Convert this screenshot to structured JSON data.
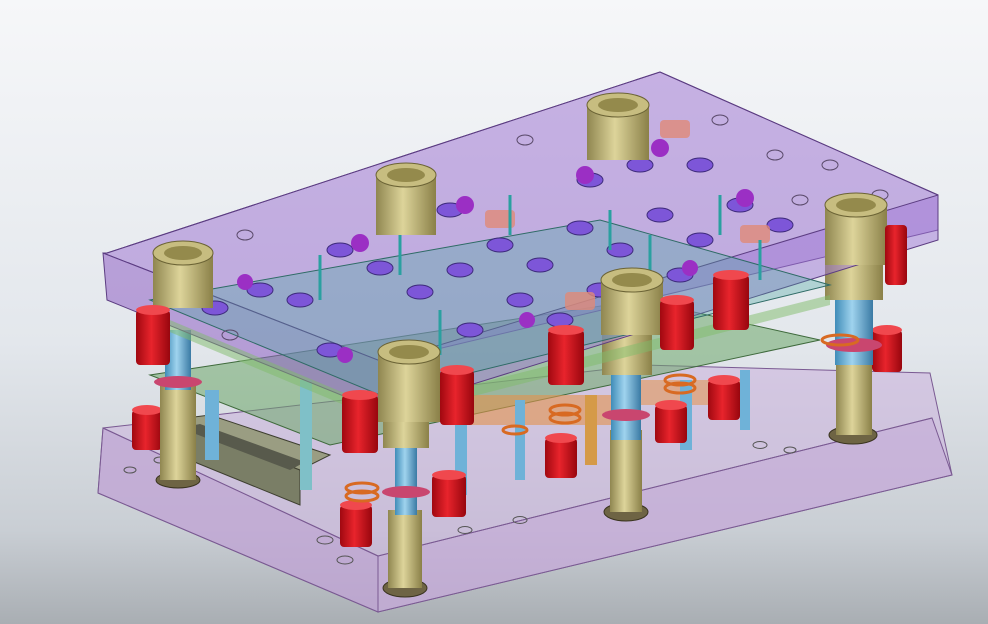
{
  "viewport": {
    "background_top": "#f6f7f9",
    "background_mid": "#dfe4ea",
    "background_bottom": "#a9aeb3"
  },
  "model": {
    "top_plate_color": "#9b6fd0",
    "bottom_plate_color": "#c8a8d8",
    "guide_bushing_color": "#bdb37a",
    "post_color": "#6fb2d8",
    "red_block_color": "#d0141e",
    "plate_edge_color": "#6a4a8a"
  }
}
